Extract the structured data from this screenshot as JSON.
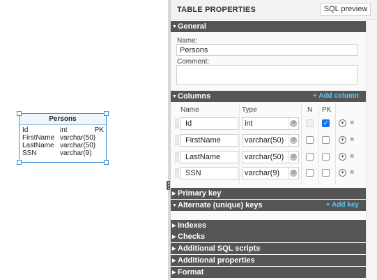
{
  "diagram": {
    "entity": {
      "title": "Persons",
      "rows": [
        {
          "name": "Id",
          "type": "int",
          "key": "PK"
        },
        {
          "name": "FirstName",
          "type": "varchar(50)",
          "key": ""
        },
        {
          "name": "LastName",
          "type": "varchar(50)",
          "key": ""
        },
        {
          "name": "SSN",
          "type": "varchar(9)",
          "key": ""
        }
      ]
    }
  },
  "panel": {
    "title": "TABLE PROPERTIES",
    "sql_preview": "SQL preview",
    "general": {
      "header": "General",
      "name_label": "Name:",
      "name_value": "Persons",
      "comment_label": "Comment:",
      "comment_value": ""
    },
    "columns": {
      "header": "Columns",
      "add": "+ Add column",
      "head_name": "Name",
      "head_type": "Type",
      "head_n": "N",
      "head_pk": "PK",
      "rows": [
        {
          "name": "Id",
          "type": "int",
          "n": false,
          "n_disabled": true,
          "pk": true
        },
        {
          "name": "FirstName",
          "type": "varchar(50)",
          "n": false,
          "n_disabled": false,
          "pk": false
        },
        {
          "name": "LastName",
          "type": "varchar(50)",
          "n": false,
          "n_disabled": false,
          "pk": false
        },
        {
          "name": "SSN",
          "type": "varchar(9)",
          "n": false,
          "n_disabled": false,
          "pk": false
        }
      ]
    },
    "primary_key": "Primary key",
    "alternate_keys": {
      "header": "Alternate (unique) keys",
      "add": "+ Add key"
    },
    "indexes": "Indexes",
    "checks": "Checks",
    "sql_scripts": "Additional SQL scripts",
    "additional_properties": "Additional properties",
    "format": "Format"
  },
  "colors": {
    "accent": "#3a8fd6",
    "section_bg": "#555555",
    "add_link": "#5dc3f5",
    "checkbox_checked": "#1a73e8"
  }
}
